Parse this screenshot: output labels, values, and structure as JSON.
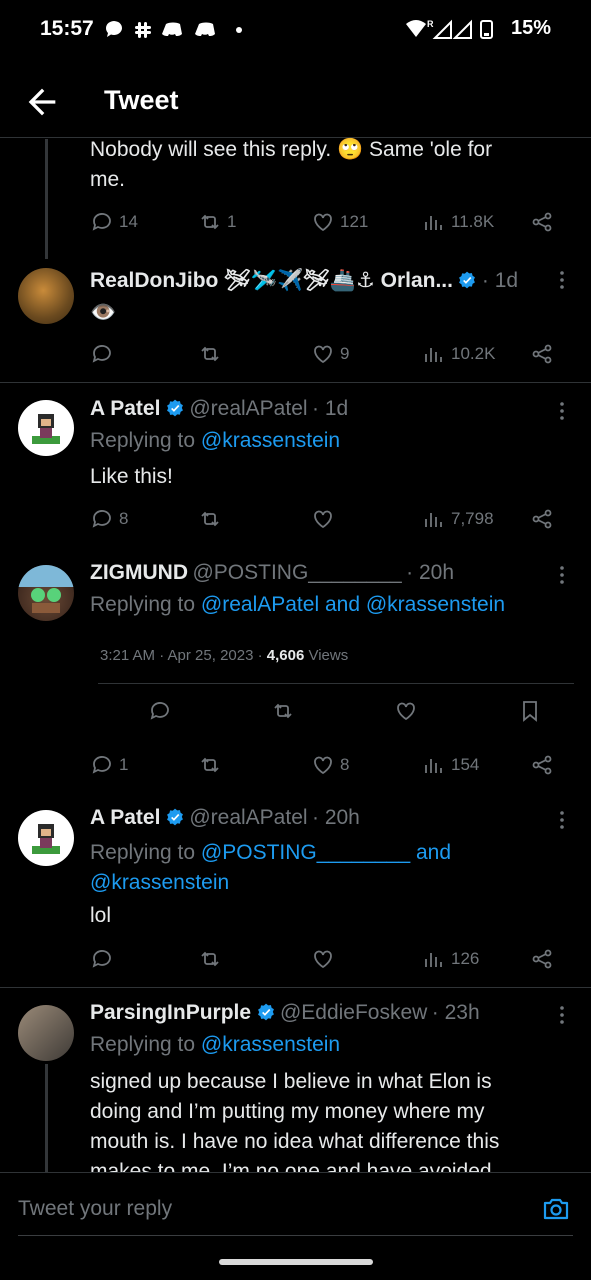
{
  "status_bar": {
    "time": "15:57",
    "notif_icons": [
      "chat-bubble-icon",
      "slack-icon",
      "discord-icon",
      "discord-icon",
      "dot-icon"
    ],
    "battery": "15%",
    "network": "R"
  },
  "header": {
    "title": "Tweet"
  },
  "tweets": [
    {
      "text": "Nobody will see this reply. 🙄 Same 'ole for me.",
      "text_line1": "Nobody will see this reply. 🙄 Same 'ole for",
      "text_line2": "me.",
      "replies": "14",
      "retweets": "1",
      "likes": "121",
      "views": "11.8K"
    },
    {
      "name": "RealDonJibo 🛩🛩️✈️🛩🚢⚓ Orlan...",
      "verified": true,
      "time": "· 1d",
      "text": "👁️",
      "replies": "",
      "retweets": "",
      "likes": "9",
      "views": "10.2K"
    },
    {
      "name": "A Patel",
      "verified": true,
      "handle": "@realAPatel",
      "time": "· 1d",
      "replying_prefix": "Replying to ",
      "replying_to": "@krassenstein",
      "text": "Like this!",
      "replies": "8",
      "retweets": "",
      "likes": "",
      "views": "7,798"
    },
    {
      "name": "ZIGMUND",
      "verified": false,
      "handle": "@POSTING________",
      "time": "· 20h",
      "replying_prefix": "Replying to ",
      "replying_to_1": "@realAPatel",
      "replying_and": " and ",
      "replying_to_2": "@krassenstein",
      "timestamp": "3:21 AM · Apr 25, 2023 · ",
      "view_count": "4,606",
      "view_label": " Views",
      "replies": "1",
      "retweets": "",
      "likes": "8",
      "views": "154"
    },
    {
      "name": "A Patel",
      "verified": true,
      "handle": "@realAPatel",
      "time": "· 20h",
      "replying_prefix": "Replying to ",
      "replying_to_1": "@POSTING________",
      "replying_and": " and",
      "replying_to_2": "@krassenstein",
      "text": "lol",
      "replies": "",
      "retweets": "",
      "likes": "",
      "views": "126"
    },
    {
      "name": "ParsingInPurple",
      "verified": true,
      "handle": "@EddieFoskew",
      "time": "· 23h",
      "replying_prefix": "Replying to ",
      "replying_to": "@krassenstein",
      "text_line1": "signed up because I believe in what Elon is",
      "text_line2": "doing and I’m putting my money where my",
      "text_line3": "mouth is. I have no idea what difference this",
      "text_line4": "makes to me. I’m no one and have avoided"
    }
  ],
  "reply_bar": {
    "placeholder": "Tweet your reply"
  },
  "colors": {
    "accent": "#1d9bf0",
    "muted": "#71767b",
    "divider": "#2f3336",
    "background": "#000000"
  }
}
